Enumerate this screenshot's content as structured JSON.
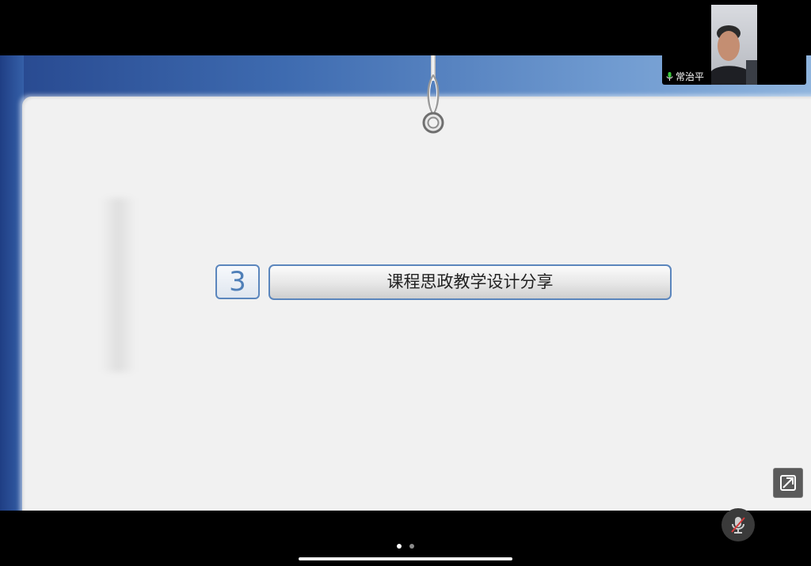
{
  "slide": {
    "section_number": "3",
    "section_title": "课程思政教学设计分享"
  },
  "video": {
    "participant_name": "常治平",
    "mic_status": "active"
  },
  "controls": {
    "share_icon": "share-screen-icon",
    "mic_icon": "microphone-muted-icon"
  },
  "pager": {
    "page_count": 2,
    "current_page": 1
  },
  "colors": {
    "slide_header_dark": "#27488f",
    "slide_header_light": "#8fb4dd",
    "slide_panel": "#f1f1f1",
    "box_border": "#5b86bd",
    "mic_active": "#3cc93c",
    "mic_muted_slash": "#d63b3b"
  }
}
